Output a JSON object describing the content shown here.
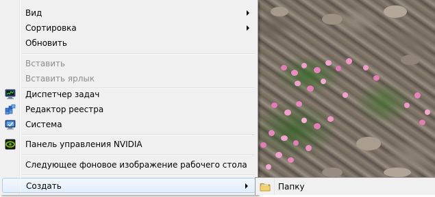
{
  "context_menu": {
    "items": [
      {
        "label": "Вид",
        "has_submenu": true,
        "enabled": true
      },
      {
        "label": "Сортировка",
        "has_submenu": true,
        "enabled": true
      },
      {
        "label": "Обновить",
        "has_submenu": false,
        "enabled": true
      },
      {
        "label": "Вставить",
        "has_submenu": false,
        "enabled": false
      },
      {
        "label": "Вставить ярлык",
        "has_submenu": false,
        "enabled": false
      },
      {
        "label": "Диспетчер задач",
        "icon": "task-manager-icon",
        "has_submenu": false,
        "enabled": true
      },
      {
        "label": "Редактор реестра",
        "icon": "registry-editor-icon",
        "has_submenu": false,
        "enabled": true
      },
      {
        "label": "Система",
        "icon": "system-icon",
        "has_submenu": false,
        "enabled": true
      },
      {
        "label": "Панель управления NVIDIA",
        "icon": "nvidia-icon",
        "has_submenu": false,
        "enabled": true
      },
      {
        "label": "Следующее фоновое изображение рабочего стола",
        "has_submenu": false,
        "enabled": true
      },
      {
        "label": "Создать",
        "has_submenu": true,
        "enabled": true,
        "highlighted": true
      }
    ]
  },
  "create_submenu": {
    "items": [
      {
        "label": "Папку",
        "icon": "folder-icon"
      }
    ]
  },
  "colors": {
    "menu_background": "#f0f0f0",
    "disabled_text": "#8d8d8d",
    "highlight_border": "#aeccf1"
  }
}
